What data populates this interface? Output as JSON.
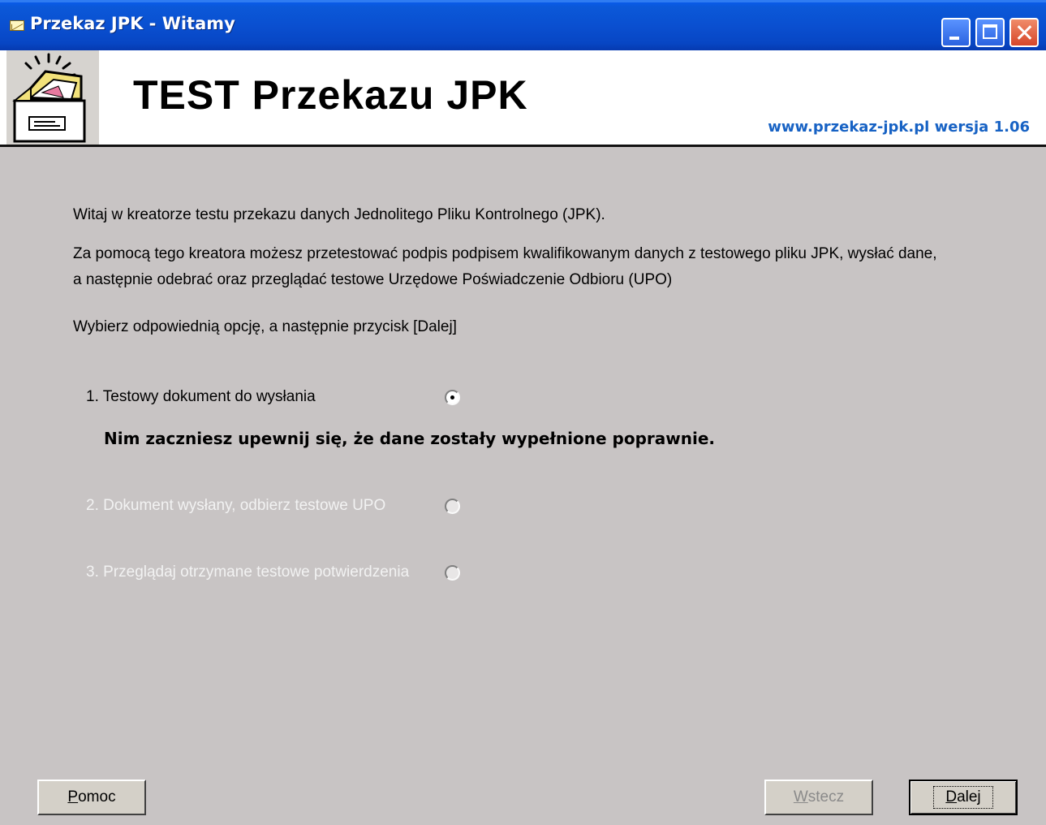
{
  "window": {
    "title": "Przekaz JPK - Witamy"
  },
  "header": {
    "heading": "TEST Przekazu JPK",
    "website": "www.przekaz-jpk.pl wersja 1.06"
  },
  "intro": {
    "line1": "Witaj w kreatorze testu przekazu danych Jednolitego Pliku Kontrolnego (JPK).",
    "line2": "Za pomocą tego kreatora możesz przetestować podpis podpisem kwalifikowanym danych z testowego pliku JPK, wysłać dane,",
    "line3": "a następnie odebrać oraz przeglądać testowe Urzędowe Poświadczenie Odbioru (UPO)",
    "line4": "Wybierz odpowiednią opcję, a następnie przycisk [Dalej]"
  },
  "options": [
    {
      "label": "1. Testowy dokument do wysłania",
      "selected": true,
      "enabled": true
    },
    {
      "label": "2. Dokument wysłany, odbierz testowe UPO",
      "selected": false,
      "enabled": false
    },
    {
      "label": "3. Przeglądaj otrzymane testowe potwierdzenia",
      "selected": false,
      "enabled": false
    }
  ],
  "warning": "Nim zaczniesz upewnij się, że dane zostały wypełnione poprawnie.",
  "buttons": {
    "help_first": "P",
    "help_rest": "omoc",
    "back_first": "W",
    "back_rest": "stecz",
    "next_first": "D",
    "next_rest": "alej"
  },
  "colors": {
    "titlebar": "#0a4fd0",
    "background": "#c8c4c4",
    "website": "#1762c4"
  }
}
